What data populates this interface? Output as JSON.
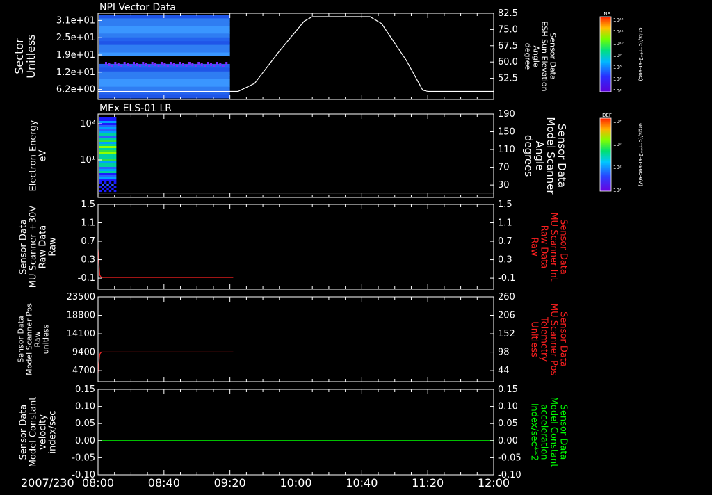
{
  "colors": {
    "background": "#000000",
    "axes": "#ffffff",
    "red_trace": "#ff2020",
    "green_trace": "#00ff00",
    "spectro_blue": "#2f7df2",
    "spectro_violet": "#7a2fff"
  },
  "footer": {
    "date_label": "2007/230",
    "x_ticks": [
      "08:00",
      "08:40",
      "09:20",
      "10:00",
      "10:40",
      "11:20",
      "12:00"
    ]
  },
  "colorbars": [
    {
      "tag": "NF",
      "unit_label": "cnts/(cm**2-sr-sec)",
      "tick_labels": [
        "10¹²",
        "10¹¹",
        "10¹⁰",
        "10⁹",
        "10⁸",
        "10⁷",
        "10⁶"
      ]
    },
    {
      "tag": "DEF",
      "unit_label": "ergs/(cm**2-sr-sec-eV)",
      "tick_labels": [
        "10⁴",
        "10³",
        "10²",
        "10¹"
      ]
    }
  ],
  "chart_data": [
    {
      "type": "heatmap",
      "title": "NPI Vector Data",
      "left_label_lines": [
        "Sector",
        "Unitless"
      ],
      "right_label_lines": [
        "Sensor Data",
        "ESH Sun Elevation",
        "Angle",
        "degree"
      ],
      "y_left_ticks": [
        "3.1e+01",
        "2.5e+01",
        "1.9e+01",
        "1.2e+01",
        "6.2e+00"
      ],
      "y_right_ticks": [
        "82.5",
        "75.0",
        "67.5",
        "60.0",
        "52.5"
      ],
      "y_right_range": [
        45,
        82.5
      ],
      "x_range": [
        "08:00",
        "12:00"
      ],
      "spectrogram_extent": [
        "08:00",
        "09:20"
      ],
      "overlay_line": {
        "name": "ESH Sun Elevation",
        "color": "#ffffff",
        "points": [
          [
            "08:00",
            48.5
          ],
          [
            "09:25",
            48.5
          ],
          [
            "09:35",
            52
          ],
          [
            "09:50",
            66
          ],
          [
            "10:05",
            79
          ],
          [
            "10:10",
            81
          ],
          [
            "10:45",
            81
          ],
          [
            "10:52",
            78
          ],
          [
            "11:07",
            62
          ],
          [
            "11:17",
            49
          ],
          [
            "11:20",
            48.5
          ],
          [
            "12:00",
            48.5
          ]
        ]
      }
    },
    {
      "type": "heatmap",
      "title": "MEx ELS-01 LR",
      "left_label_lines": [
        "Electron Energy",
        "eV"
      ],
      "right_label_lines": [
        "Sensor Data",
        "Model Scanner",
        "Angle",
        "degrees"
      ],
      "y_left_ticks": [
        "10²",
        "10¹"
      ],
      "y_right_ticks": [
        "190",
        "150",
        "110",
        "70",
        "30"
      ],
      "y_right_range": [
        0,
        190
      ],
      "spectrogram_extent": [
        "08:00",
        "08:11"
      ],
      "overlay_line": {
        "name": "Model Scanner Angle",
        "color": "#ffffff",
        "points": [
          [
            "08:00",
            10
          ],
          [
            "12:00",
            10
          ]
        ]
      }
    },
    {
      "type": "line",
      "left_label_lines": [
        "Sensor Data",
        "MU Scanner +30V",
        "Raw Data",
        "Raw"
      ],
      "right_label_lines": [
        "Sensor Data",
        "MU Scanner Int",
        "Raw Data",
        "Raw"
      ],
      "y_left_ticks": [
        "1.5",
        "1.1",
        "0.7",
        "0.3",
        "-0.1"
      ],
      "y_right_ticks": [
        "1.5",
        "1.1",
        "0.7",
        "0.3",
        "-0.1"
      ],
      "ylim": [
        -0.3,
        1.5
      ],
      "series": [
        {
          "color": "#ff2020",
          "points": [
            [
              "08:00",
              0.55
            ],
            [
              "08:01",
              0.0
            ],
            [
              "08:02",
              -0.05
            ],
            [
              "09:22",
              -0.05
            ]
          ]
        }
      ]
    },
    {
      "type": "line",
      "left_label_lines": [
        "Sensor Data",
        "Model Scanner Pos",
        "Raw",
        "unitless"
      ],
      "right_label_lines": [
        "Sensor Data",
        "MU Scanner Pos",
        "Telemetry",
        "Unitless"
      ],
      "y_left_ticks": [
        "23500",
        "18800",
        "14100",
        "9400",
        "4700"
      ],
      "y_right_ticks": [
        "260",
        "206",
        "152",
        "98",
        "44"
      ],
      "ylim": [
        0,
        23500
      ],
      "series": [
        {
          "color": "#ff2020",
          "points": [
            [
              "08:00",
              2500
            ],
            [
              "08:01",
              7600
            ],
            [
              "08:02",
              8200
            ],
            [
              "09:22",
              8200
            ]
          ]
        }
      ]
    },
    {
      "type": "line",
      "left_label_lines": [
        "Sensor Data",
        "Model Constant",
        "velocity",
        "index/sec"
      ],
      "right_label_lines": [
        "Sensor Data",
        "Model Constant",
        "acceleration",
        "index/sec**2"
      ],
      "y_left_ticks": [
        "0.15",
        "0.10",
        "0.05",
        "0.00",
        "-0.05",
        "-0.10"
      ],
      "y_right_ticks": [
        "0.15",
        "0.10",
        "0.05",
        "0.00",
        "-0.05",
        "-0.10"
      ],
      "ylim": [
        -0.1,
        0.15
      ],
      "series": [
        {
          "color": "#00ff00",
          "points": [
            [
              "08:00",
              0.0
            ],
            [
              "12:00",
              0.0
            ]
          ]
        }
      ]
    }
  ]
}
